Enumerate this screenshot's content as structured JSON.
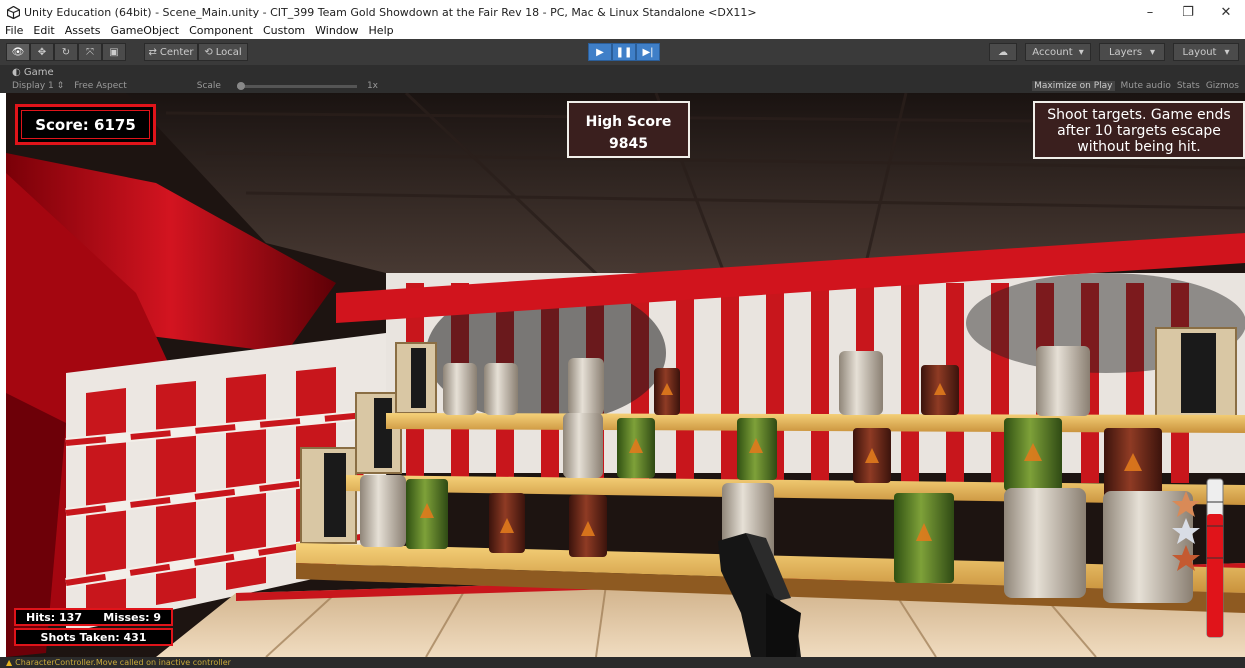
{
  "window": {
    "title": "Unity Education (64bit) - Scene_Main.unity - CIT_399 Team Gold Showdown at the Fair Rev 18 - PC, Mac & Linux Standalone <DX11>",
    "minimize_glyph": "–",
    "restore_glyph": "❐",
    "close_glyph": "✕"
  },
  "menu": [
    "File",
    "Edit",
    "Assets",
    "GameObject",
    "Component",
    "Custom",
    "Window",
    "Help"
  ],
  "toolbar": {
    "center_label": "Center",
    "local_label": "Local",
    "account_label": "Account",
    "layers_label": "Layers",
    "layout_label": "Layout"
  },
  "game_view": {
    "tab_label": "Game",
    "display_label": "Display 1",
    "aspect_label": "Free Aspect",
    "scale_label": "Scale",
    "scale_value": "1x",
    "maximize_label": "Maximize on Play",
    "mute_label": "Mute audio",
    "stats_label": "Stats",
    "gizmos_label": "Gizmos"
  },
  "hud": {
    "score": "Score: 6175",
    "high_score_label": "High Score",
    "high_score_value": "9845",
    "help_line1": "Shoot targets. Game ends",
    "help_line2": "after 10 targets escape",
    "help_line3": "without being hit.",
    "hits": "Hits: 137",
    "misses": "Misses: 9",
    "shots": "Shots Taken: 431"
  },
  "console": {
    "message": "CharacterController.Move called on inactive controller"
  },
  "colors": {
    "hud_red": "#e0141a",
    "hud_panel": "#3a1f1e",
    "play_blue": "#3f7fc8"
  }
}
